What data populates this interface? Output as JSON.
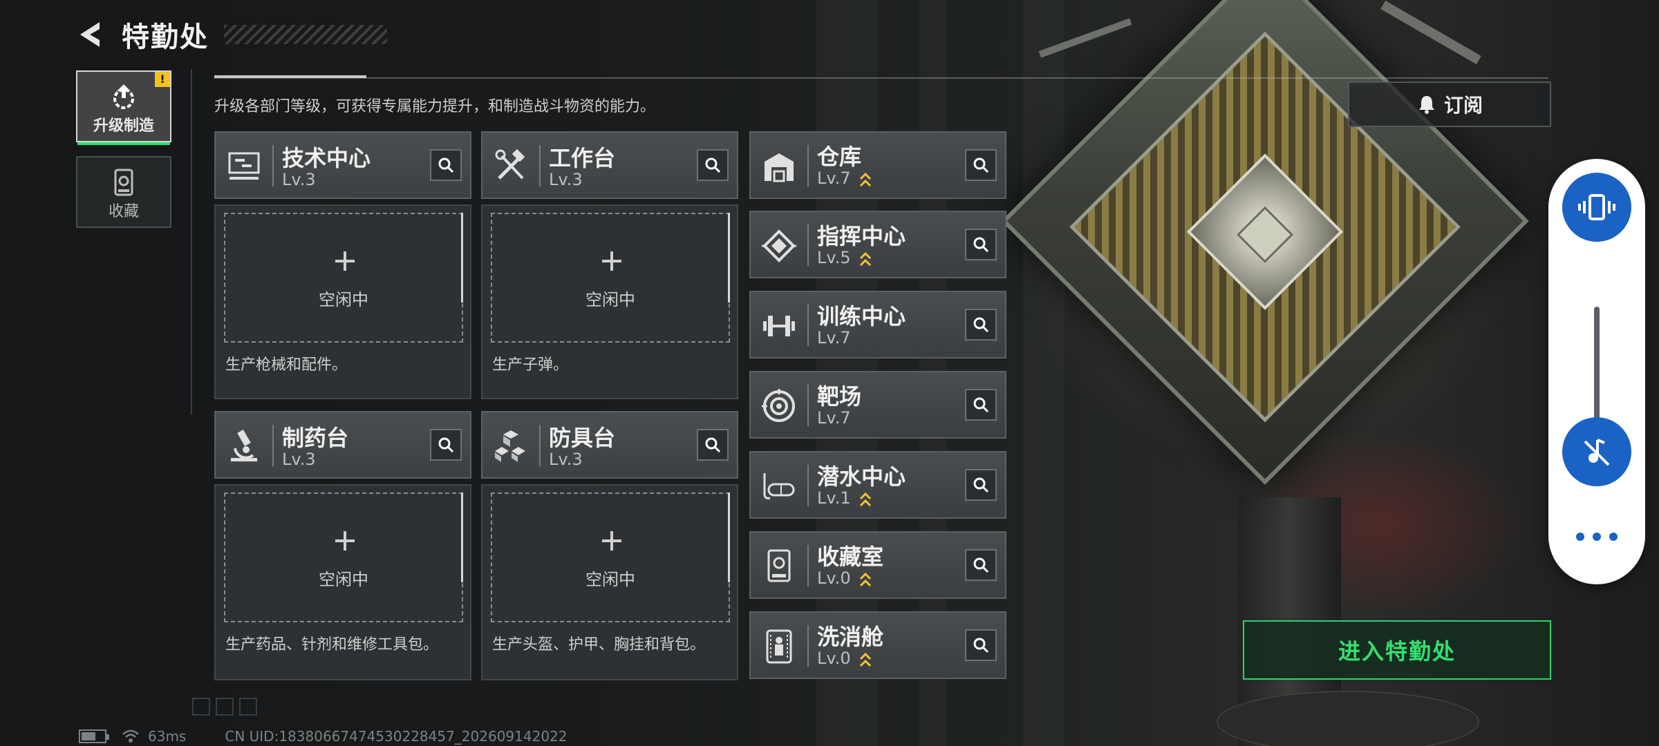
{
  "header": {
    "title": "特勤处"
  },
  "side_tabs": [
    {
      "label": "升级制造",
      "active": true,
      "alert": "!"
    },
    {
      "label": "收藏",
      "active": false
    }
  ],
  "description": "升级各部门等级，可获得专属能力提升，和制造战斗物资的能力。",
  "subscribe": {
    "label": "订阅",
    "icon": "bell-icon"
  },
  "workbenches": [
    {
      "name": "技术中心",
      "level": "Lv.3",
      "slot_status": "空闲中",
      "desc": "生产枪械和配件。",
      "icon": "tech-center-icon"
    },
    {
      "name": "工作台",
      "level": "Lv.3",
      "slot_status": "空闲中",
      "desc": "生产子弹。",
      "icon": "workbench-tools-icon"
    },
    {
      "name": "制药台",
      "level": "Lv.3",
      "slot_status": "空闲中",
      "desc": "生产药品、针剂和维修工具包。",
      "icon": "microscope-icon"
    },
    {
      "name": "防具台",
      "level": "Lv.3",
      "slot_status": "空闲中",
      "desc": "生产头盔、护甲、胸挂和背包。",
      "icon": "cubes-icon"
    }
  ],
  "facilities": [
    {
      "name": "仓库",
      "level": "Lv.7",
      "upgradable": true,
      "icon": "warehouse-icon"
    },
    {
      "name": "指挥中心",
      "level": "Lv.5",
      "upgradable": true,
      "icon": "command-chip-icon"
    },
    {
      "name": "训练中心",
      "level": "Lv.7",
      "upgradable": false,
      "icon": "dumbbell-icon"
    },
    {
      "name": "靶场",
      "level": "Lv.7",
      "upgradable": false,
      "icon": "target-icon"
    },
    {
      "name": "潜水中心",
      "level": "Lv.1",
      "upgradable": true,
      "icon": "diving-mask-icon"
    },
    {
      "name": "收藏室",
      "level": "Lv.0",
      "upgradable": true,
      "icon": "display-case-icon"
    },
    {
      "name": "洗消舱",
      "level": "Lv.0",
      "upgradable": true,
      "icon": "decon-pod-icon"
    }
  ],
  "enter_button": "进入特勤处",
  "status_bar": {
    "ping": "63ms",
    "uid": "CN UID:18380667474530228457_202609142022"
  },
  "colors": {
    "accent_green": "#33e070",
    "upgrade_gold": "#f3c23a",
    "overlay_blue": "#1a62c4"
  }
}
